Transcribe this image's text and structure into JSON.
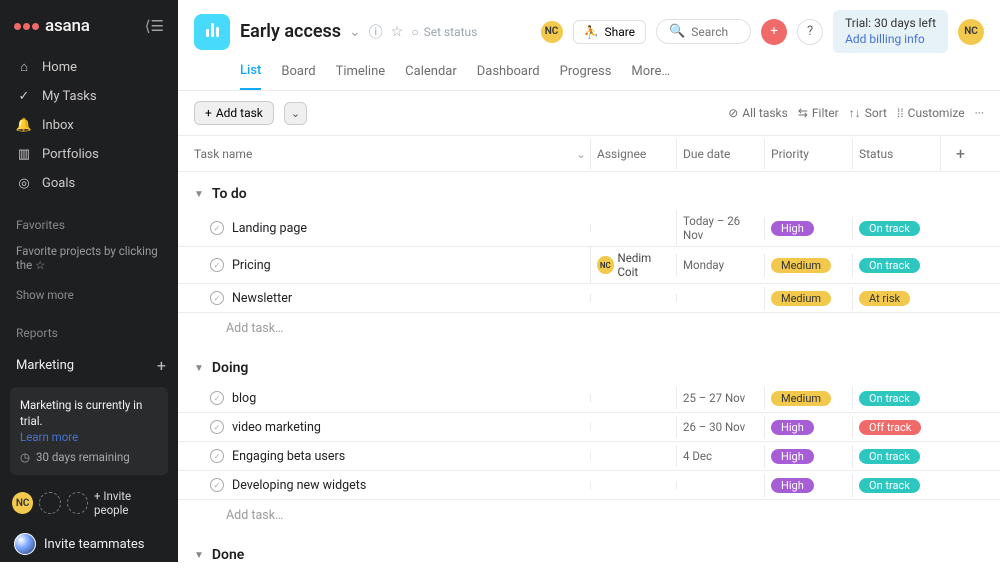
{
  "brand": "asana",
  "sidebar": {
    "nav": [
      {
        "icon": "home",
        "label": "Home"
      },
      {
        "icon": "check",
        "label": "My Tasks"
      },
      {
        "icon": "bell",
        "label": "Inbox"
      },
      {
        "icon": "chart",
        "label": "Portfolios"
      },
      {
        "icon": "target",
        "label": "Goals"
      }
    ],
    "favorites_label": "Favorites",
    "favorites_hint": "Favorite projects by clicking the ☆",
    "show_more": "Show more",
    "reports_label": "Reports",
    "team_name": "Marketing",
    "trial_line": "Marketing is currently in trial.",
    "trial_learn_more": "Learn more",
    "trial_remaining": "30 days remaining",
    "invite_people": "+ Invite people",
    "invite_teammates": "Invite teammates",
    "avatar_initials": "NC"
  },
  "header": {
    "project_title": "Early access",
    "set_status": "Set status",
    "share": "Share",
    "search_placeholder": "Search",
    "trial": "Trial: 30 days left",
    "add_billing": "Add billing info"
  },
  "tabs": [
    "List",
    "Board",
    "Timeline",
    "Calendar",
    "Dashboard",
    "Progress",
    "More…"
  ],
  "active_tab": 0,
  "toolbar": {
    "add_task": "Add task",
    "all_tasks": "All tasks",
    "filter": "Filter",
    "sort": "Sort",
    "customize": "Customize"
  },
  "columns": [
    "Task name",
    "Assignee",
    "Due date",
    "Priority",
    "Status"
  ],
  "sections": [
    {
      "name": "To do",
      "tasks": [
        {
          "name": "Landing page",
          "assignee": "",
          "due": "Today – 26 Nov",
          "priority": "High",
          "status": "On track"
        },
        {
          "name": "Pricing",
          "assignee": "Nedim Coit",
          "assignee_initials": "NC",
          "due": "Monday",
          "priority": "Medium",
          "status": "On track"
        },
        {
          "name": "Newsletter",
          "assignee": "",
          "due": "",
          "priority": "Medium",
          "status": "At risk"
        }
      ],
      "add": "Add task…"
    },
    {
      "name": "Doing",
      "tasks": [
        {
          "name": "blog",
          "assignee": "",
          "due": "25 – 27 Nov",
          "priority": "Medium",
          "status": "On track"
        },
        {
          "name": "video marketing",
          "assignee": "",
          "due": "26 – 30 Nov",
          "priority": "High",
          "status": "Off track"
        },
        {
          "name": "Engaging beta users",
          "assignee": "",
          "due": "4 Dec",
          "priority": "High",
          "status": "On track"
        },
        {
          "name": "Developing new widgets",
          "assignee": "",
          "due": "",
          "priority": "High",
          "status": "On track"
        }
      ],
      "add": "Add task…"
    },
    {
      "name": "Done",
      "tasks": [],
      "add": null
    }
  ],
  "nav_icons": {
    "home": "⌂",
    "check": "✓",
    "bell": "🔔",
    "chart": "▥",
    "target": "◎"
  }
}
